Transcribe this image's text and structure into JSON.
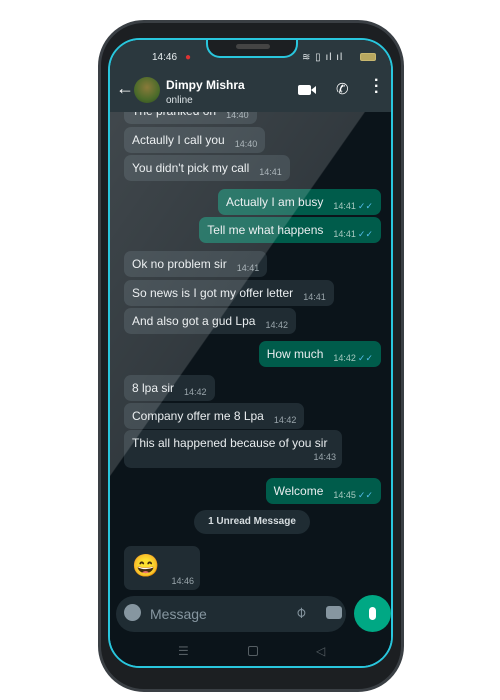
{
  "status_bar": {
    "time": "14:46"
  },
  "header": {
    "contact_name": "Dimpy Mishra",
    "status": "online"
  },
  "messages": [
    {
      "dir": "in",
      "text": "The pranked on",
      "time": "14:40"
    },
    {
      "dir": "in",
      "text": "Actaully I call you",
      "time": "14:40"
    },
    {
      "dir": "in",
      "text": "You didn't pick my call",
      "time": "14:41"
    },
    {
      "dir": "out",
      "text": "Actually I am busy",
      "time": "14:41",
      "ticks": "✓✓"
    },
    {
      "dir": "out",
      "text": "Tell me what happens",
      "time": "14:41",
      "ticks": "✓✓"
    },
    {
      "dir": "in",
      "text": "Ok no problem sir",
      "time": "14:41"
    },
    {
      "dir": "in",
      "text": "So news is I got my offer letter",
      "time": "14:41"
    },
    {
      "dir": "in",
      "text": "And also got a gud Lpa",
      "time": "14:42"
    },
    {
      "dir": "out",
      "text": "How much",
      "time": "14:42",
      "ticks": "✓✓"
    },
    {
      "dir": "in",
      "text": "8 lpa sir",
      "time": "14:42"
    },
    {
      "dir": "in",
      "text": "Company offer me 8 Lpa",
      "time": "14:42"
    },
    {
      "dir": "in",
      "text": "This all happened because of you sir",
      "time": "14:43"
    },
    {
      "dir": "out",
      "text": "Welcome",
      "time": "14:45",
      "ticks": "✓✓"
    },
    {
      "dir": "in",
      "text": "😄",
      "time": "14:46"
    }
  ],
  "unread_label": "1 Unread Message",
  "composer": {
    "placeholder": "Message"
  },
  "colors": {
    "accent": "#00a884",
    "outgoing": "#005c4b",
    "incoming": "#202c33",
    "frame": "#29c6dd"
  }
}
